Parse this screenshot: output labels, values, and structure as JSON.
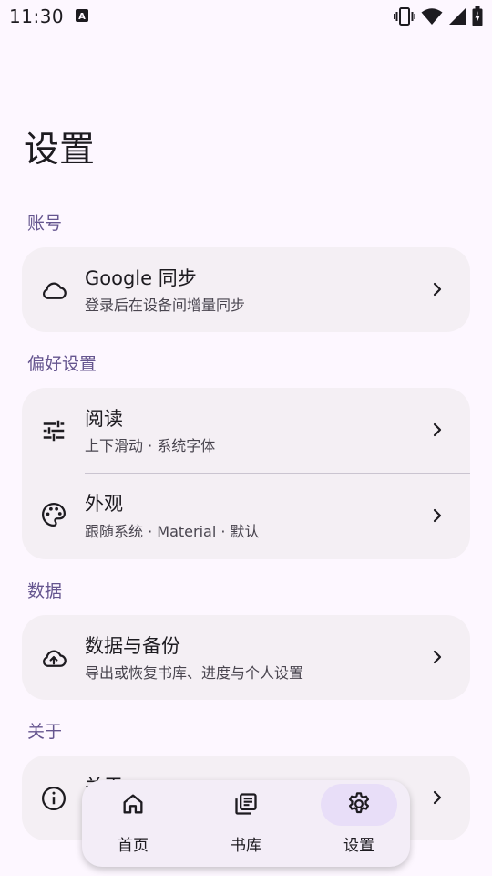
{
  "status_bar": {
    "time": "11:30",
    "app_icon_letter": "A",
    "icons": [
      "vibrate-icon",
      "wifi-icon",
      "cellular-signal-icon",
      "battery-icon"
    ]
  },
  "page": {
    "title": "设置"
  },
  "sections": {
    "account": {
      "header": "账号",
      "items": [
        {
          "title": "Google 同步",
          "subtitle": "登录后在设备间增量同步",
          "icon": "cloud-icon"
        }
      ]
    },
    "preferences": {
      "header": "偏好设置",
      "items": [
        {
          "title": "阅读",
          "subtitle": "上下滑动 · 系统字体",
          "icon": "tune-sliders-icon"
        },
        {
          "title": "外观",
          "subtitle": "跟随系统 · Material · 默认",
          "icon": "palette-icon"
        }
      ]
    },
    "data": {
      "header": "数据",
      "items": [
        {
          "title": "数据与备份",
          "subtitle": "导出或恢复书库、进度与个人设置",
          "icon": "cloud-upload-icon"
        }
      ]
    },
    "about": {
      "header": "关于",
      "items": [
        {
          "title": "关于",
          "icon": "info-icon"
        }
      ]
    }
  },
  "nav": {
    "items": [
      {
        "label": "首页",
        "icon": "home-icon",
        "selected": false
      },
      {
        "label": "书库",
        "icon": "library-icon",
        "selected": false
      },
      {
        "label": "设置",
        "icon": "settings-gear-icon",
        "selected": true
      }
    ]
  },
  "colors": {
    "background": "#FDF7FF",
    "card": "#F4EFF4",
    "section_header": "#65558F",
    "nav_indicator": "#E8DEF8",
    "nav_bar": "#F3EDF7",
    "text_primary": "#1D1B20",
    "text_secondary": "#49454F"
  }
}
